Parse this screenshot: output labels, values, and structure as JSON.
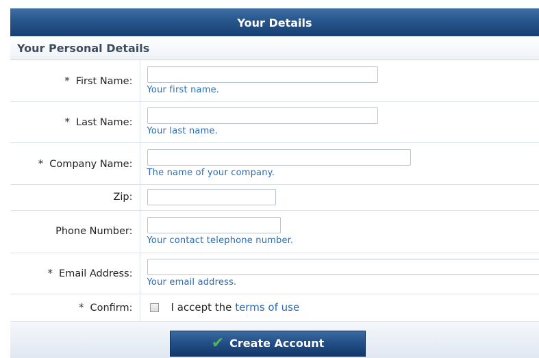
{
  "header": {
    "title": "Your Details"
  },
  "section": {
    "title": "Your Personal Details"
  },
  "fields": {
    "first_name": {
      "required_mark": "*",
      "label": "First Name:",
      "value": "",
      "hint": "Your first name."
    },
    "last_name": {
      "required_mark": "*",
      "label": "Last Name:",
      "value": "",
      "hint": "Your last name."
    },
    "company_name": {
      "required_mark": "*",
      "label": "Company Name:",
      "value": "",
      "hint": "The name of your company."
    },
    "zip": {
      "label": "Zip:",
      "value": ""
    },
    "phone_number": {
      "label": "Phone Number:",
      "value": "",
      "hint": "Your contact telephone number."
    },
    "email_address": {
      "required_mark": "*",
      "label": "Email Address:",
      "value": "",
      "hint": "Your email address."
    }
  },
  "confirm": {
    "required_mark": "*",
    "label": "Confirm:",
    "checked": false,
    "text": "I accept the",
    "link_text": "terms of use"
  },
  "footer": {
    "create_button": "Create Account",
    "create_button_icon": "checkmark-icon",
    "icon_color": "#52b848"
  },
  "colors": {
    "header_bg": "#23508a",
    "hint_text": "#2b6bb0",
    "link": "#2b6bb0"
  }
}
